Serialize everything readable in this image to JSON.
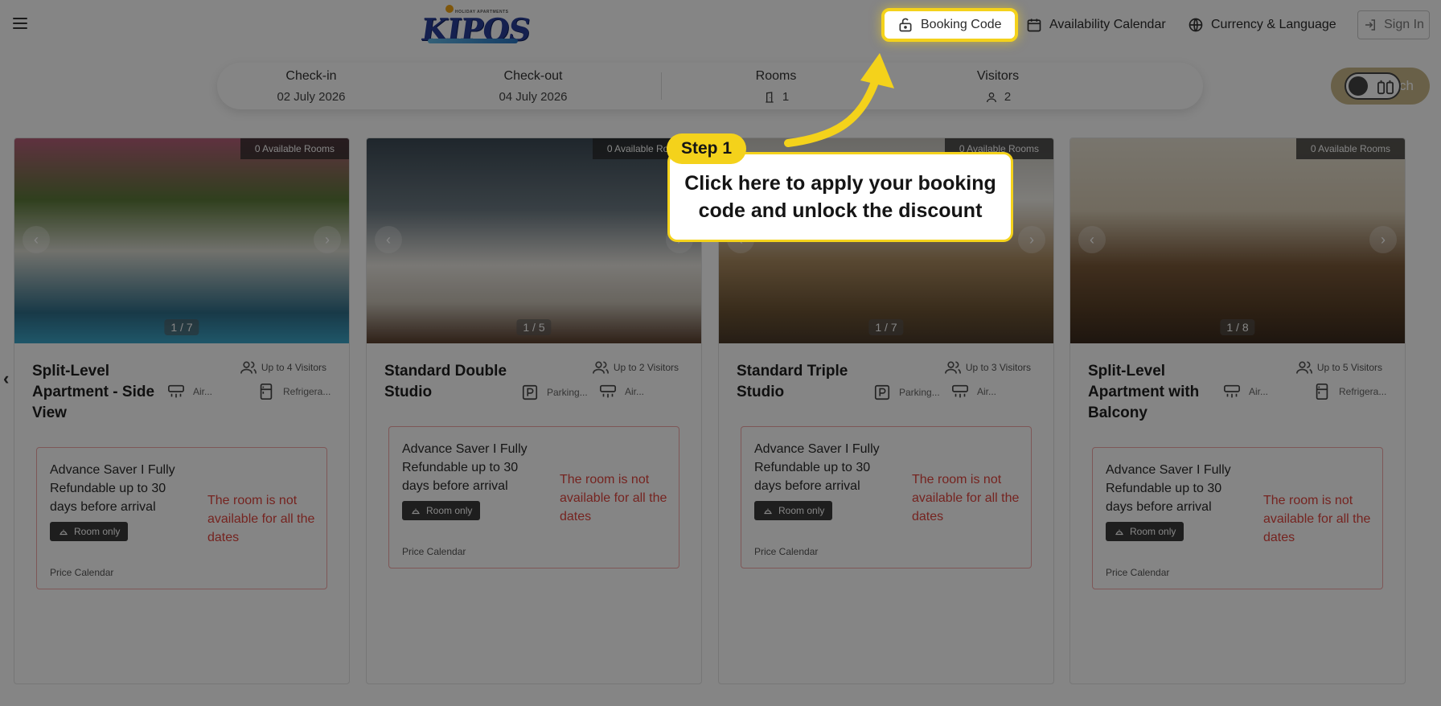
{
  "header": {
    "logo": {
      "tagline": "HOLIDAY APARTMENTS",
      "word": "KIPOS"
    },
    "booking_code_label": "Booking Code",
    "availability_calendar_label": "Availability Calendar",
    "currency_language_label": "Currency & Language",
    "sign_in_label": "Sign In"
  },
  "search": {
    "checkin_label": "Check-in",
    "checkin_value": "02 July 2026",
    "checkout_label": "Check-out",
    "checkout_value": "04 July 2026",
    "rooms_label": "Rooms",
    "rooms_value": "1",
    "visitors_label": "Visitors",
    "visitors_value": "2",
    "search_label": "Search"
  },
  "cards": [
    {
      "available": "0 Available Rooms",
      "image_counter": "1 / 7",
      "title": "Split-Level Apartment - Side View",
      "visitors": "Up to 4 Visitors",
      "amenities": [
        {
          "icon": "air-conditioner-icon",
          "label": "Air..."
        },
        {
          "icon": "refrigerator-icon",
          "label": "Refrigera..."
        }
      ],
      "rate_name": "Advance Saver I Fully Refundable up to 30 days before arrival",
      "board": "Room only",
      "not_available": "The room is not available for all the dates",
      "price_calendar": "Price Calendar"
    },
    {
      "available": "0 Available Rooms",
      "image_counter": "1 / 5",
      "title": "Standard Double Studio",
      "visitors": "Up to 2 Visitors",
      "amenities": [
        {
          "icon": "parking-icon",
          "label": "Parking..."
        },
        {
          "icon": "air-conditioner-icon",
          "label": "Air..."
        }
      ],
      "rate_name": "Advance Saver I Fully Refundable up to 30 days before arrival",
      "board": "Room only",
      "not_available": "The room is not available for all the dates",
      "price_calendar": "Price Calendar"
    },
    {
      "available": "0 Available Rooms",
      "image_counter": "1 / 7",
      "title": "Standard Triple Studio",
      "visitors": "Up to 3 Visitors",
      "amenities": [
        {
          "icon": "parking-icon",
          "label": "Parking..."
        },
        {
          "icon": "air-conditioner-icon",
          "label": "Air..."
        }
      ],
      "rate_name": "Advance Saver I Fully Refundable up to 30 days before arrival",
      "board": "Room only",
      "not_available": "The room is not available for all the dates",
      "price_calendar": "Price Calendar"
    },
    {
      "available": "0 Available Rooms",
      "image_counter": "1 / 8",
      "title": "Split-Level Apartment with Balcony",
      "visitors": "Up to 5 Visitors",
      "amenities": [
        {
          "icon": "air-conditioner-icon",
          "label": "Air..."
        },
        {
          "icon": "refrigerator-icon",
          "label": "Refrigera..."
        }
      ],
      "rate_name": "Advance Saver I Fully Refundable up to 30 days before arrival",
      "board": "Room only",
      "not_available": "The room is not available for all the dates",
      "price_calendar": "Price Calendar"
    }
  ],
  "tutorial": {
    "step_label": "Step 1",
    "message": "Click here to apply your booking code and unlock the discount"
  },
  "colors": {
    "highlight": "#f4d21b",
    "search_button": "#c9b98b",
    "unavailable_text": "#e1453f",
    "rate_border": "#f2a7a7"
  }
}
